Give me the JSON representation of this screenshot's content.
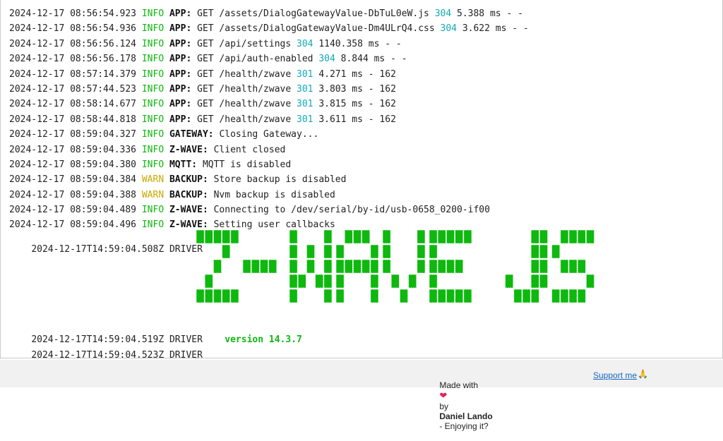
{
  "log": {
    "lines": [
      {
        "ts": "2024-12-17 08:56:54.923",
        "level": "INFO",
        "module": "APP",
        "msg": "GET /assets/DialogGatewayValue-DbTuL0eW.js",
        "status": "304",
        "rest": "5.388 ms - -"
      },
      {
        "ts": "2024-12-17 08:56:54.936",
        "level": "INFO",
        "module": "APP",
        "msg": "GET /assets/DialogGatewayValue-Dm4ULrQ4.css",
        "status": "304",
        "rest": "3.622 ms - -"
      },
      {
        "ts": "2024-12-17 08:56:56.124",
        "level": "INFO",
        "module": "APP",
        "msg": "GET /api/settings",
        "status": "304",
        "rest": "1140.358 ms - -"
      },
      {
        "ts": "2024-12-17 08:56:56.178",
        "level": "INFO",
        "module": "APP",
        "msg": "GET /api/auth-enabled",
        "status": "304",
        "rest": "8.844 ms - -"
      },
      {
        "ts": "2024-12-17 08:57:14.379",
        "level": "INFO",
        "module": "APP",
        "msg": "GET /health/zwave",
        "status": "301",
        "rest": "4.271 ms - 162"
      },
      {
        "ts": "2024-12-17 08:57:44.523",
        "level": "INFO",
        "module": "APP",
        "msg": "GET /health/zwave",
        "status": "301",
        "rest": "3.803 ms - 162"
      },
      {
        "ts": "2024-12-17 08:58:14.677",
        "level": "INFO",
        "module": "APP",
        "msg": "GET /health/zwave",
        "status": "301",
        "rest": "3.815 ms - 162"
      },
      {
        "ts": "2024-12-17 08:58:44.818",
        "level": "INFO",
        "module": "APP",
        "msg": "GET /health/zwave",
        "status": "301",
        "rest": "3.611 ms - 162"
      },
      {
        "ts": "2024-12-17 08:59:04.327",
        "level": "INFO",
        "module": "GATEWAY",
        "msg": "Closing Gateway...",
        "status": "",
        "rest": ""
      },
      {
        "ts": "2024-12-17 08:59:04.336",
        "level": "INFO",
        "module": "Z-WAVE",
        "msg": "Client closed",
        "status": "",
        "rest": ""
      },
      {
        "ts": "2024-12-17 08:59:04.380",
        "level": "INFO",
        "module": "MQTT",
        "msg": "MQTT is disabled",
        "status": "",
        "rest": ""
      },
      {
        "ts": "2024-12-17 08:59:04.384",
        "level": "WARN",
        "module": "BACKUP",
        "msg": "Store backup is disabled",
        "status": "",
        "rest": ""
      },
      {
        "ts": "2024-12-17 08:59:04.388",
        "level": "WARN",
        "module": "BACKUP",
        "msg": "Nvm backup is disabled",
        "status": "",
        "rest": ""
      },
      {
        "ts": "2024-12-17 08:59:04.489",
        "level": "INFO",
        "module": "Z-WAVE",
        "msg": "Connecting to /dev/serial/by-id/usb-0658_0200-if00",
        "status": "",
        "rest": ""
      },
      {
        "ts": "2024-12-17 08:59:04.496",
        "level": "INFO",
        "module": "Z-WAVE",
        "msg": "Setting user callbacks",
        "status": "",
        "rest": ""
      }
    ],
    "driver_lines": [
      {
        "ts": "2024-12-17T14:59:04.508Z",
        "source": "DRIVER"
      },
      {
        "ts": "2024-12-17T14:59:04.519Z",
        "source": "DRIVER",
        "version": "version 14.3.7"
      },
      {
        "ts": "2024-12-17T14:59:04.523Z",
        "source": "DRIVER"
      }
    ],
    "banner_text": "Z-WAVE JS",
    "colors": {
      "info": "#0eb80e",
      "warn": "#c9a900",
      "status": "#11a9b6",
      "banner": "#0eb80e"
    }
  },
  "footer": {
    "made_with": "Made with",
    "heart_icon": "heart-icon",
    "by": "by",
    "author": "Daniel Lando",
    "enjoying": "- Enjoying it?",
    "support": "Support me",
    "support_icon": "praying-hands-icon"
  }
}
